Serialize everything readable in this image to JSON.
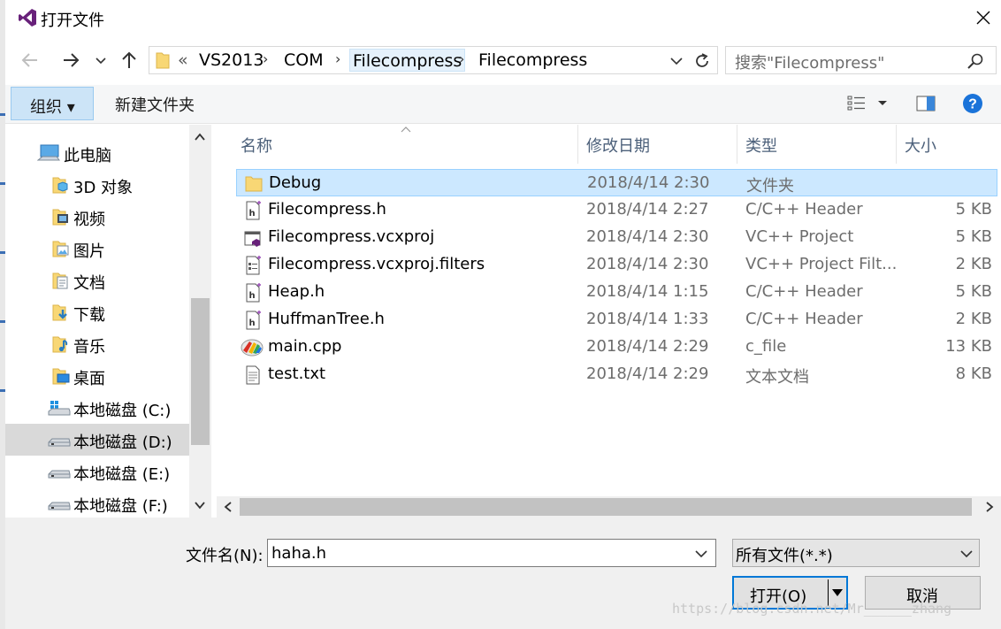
{
  "window": {
    "title": "打开文件",
    "accent_color": "#0078d7"
  },
  "address": {
    "overflow": "«",
    "segments": [
      "VS2013",
      "COM",
      "Filecompress",
      "Filecompress"
    ]
  },
  "search": {
    "placeholder": "搜索\"Filecompress\""
  },
  "toolbar": {
    "organize_label": "组织 ▾",
    "new_folder_label": "新建文件夹"
  },
  "nav": {
    "items": [
      {
        "label": "此电脑",
        "icon": "computer-icon"
      },
      {
        "label": "3D 对象",
        "icon": "3d-objects-folder-icon"
      },
      {
        "label": "视频",
        "icon": "videos-folder-icon"
      },
      {
        "label": "图片",
        "icon": "pictures-folder-icon"
      },
      {
        "label": "文档",
        "icon": "documents-folder-icon"
      },
      {
        "label": "下载",
        "icon": "downloads-folder-icon"
      },
      {
        "label": "音乐",
        "icon": "music-folder-icon"
      },
      {
        "label": "桌面",
        "icon": "desktop-folder-icon"
      },
      {
        "label": "本地磁盘 (C:)",
        "icon": "windows-drive-icon"
      },
      {
        "label": "本地磁盘 (D:)",
        "icon": "drive-icon",
        "selected": true
      },
      {
        "label": "本地磁盘 (E:)",
        "icon": "drive-icon"
      },
      {
        "label": "本地磁盘 (F:)",
        "icon": "drive-icon"
      }
    ]
  },
  "files": {
    "columns": [
      "名称",
      "修改日期",
      "类型",
      "大小"
    ],
    "rows": [
      {
        "name": "Debug",
        "date": "2018/4/14 2:30",
        "type": "文件夹",
        "size": "",
        "icon": "folder-icon",
        "selected": true
      },
      {
        "name": "Filecompress.h",
        "date": "2018/4/14 2:27",
        "type": "C/C++ Header",
        "size": "5 KB",
        "icon": "header-file-icon"
      },
      {
        "name": "Filecompress.vcxproj",
        "date": "2018/4/14 2:30",
        "type": "VC++ Project",
        "size": "5 KB",
        "icon": "vcxproj-file-icon"
      },
      {
        "name": "Filecompress.vcxproj.filters",
        "date": "2018/4/14 2:30",
        "type": "VC++ Project Filt...",
        "size": "2 KB",
        "icon": "filters-file-icon"
      },
      {
        "name": "Heap.h",
        "date": "2018/4/14 1:15",
        "type": "C/C++ Header",
        "size": "5 KB",
        "icon": "header-file-icon"
      },
      {
        "name": "HuffmanTree.h",
        "date": "2018/4/14 1:33",
        "type": "C/C++ Header",
        "size": "2 KB",
        "icon": "header-file-icon"
      },
      {
        "name": "main.cpp",
        "date": "2018/4/14 2:29",
        "type": "c_file",
        "size": "13 KB",
        "icon": "cpp-file-icon"
      },
      {
        "name": "test.txt",
        "date": "2018/4/14 2:29",
        "type": "文本文档",
        "size": "8 KB",
        "icon": "text-file-icon"
      }
    ]
  },
  "bottom": {
    "filename_label": "文件名(N):",
    "filename_value": "haha.h",
    "filter_value": "所有文件(*.*)",
    "open_label": "打开(O)",
    "cancel_label": "取消",
    "watermark": "https://blog.csdn.net/Mr______zhang"
  }
}
